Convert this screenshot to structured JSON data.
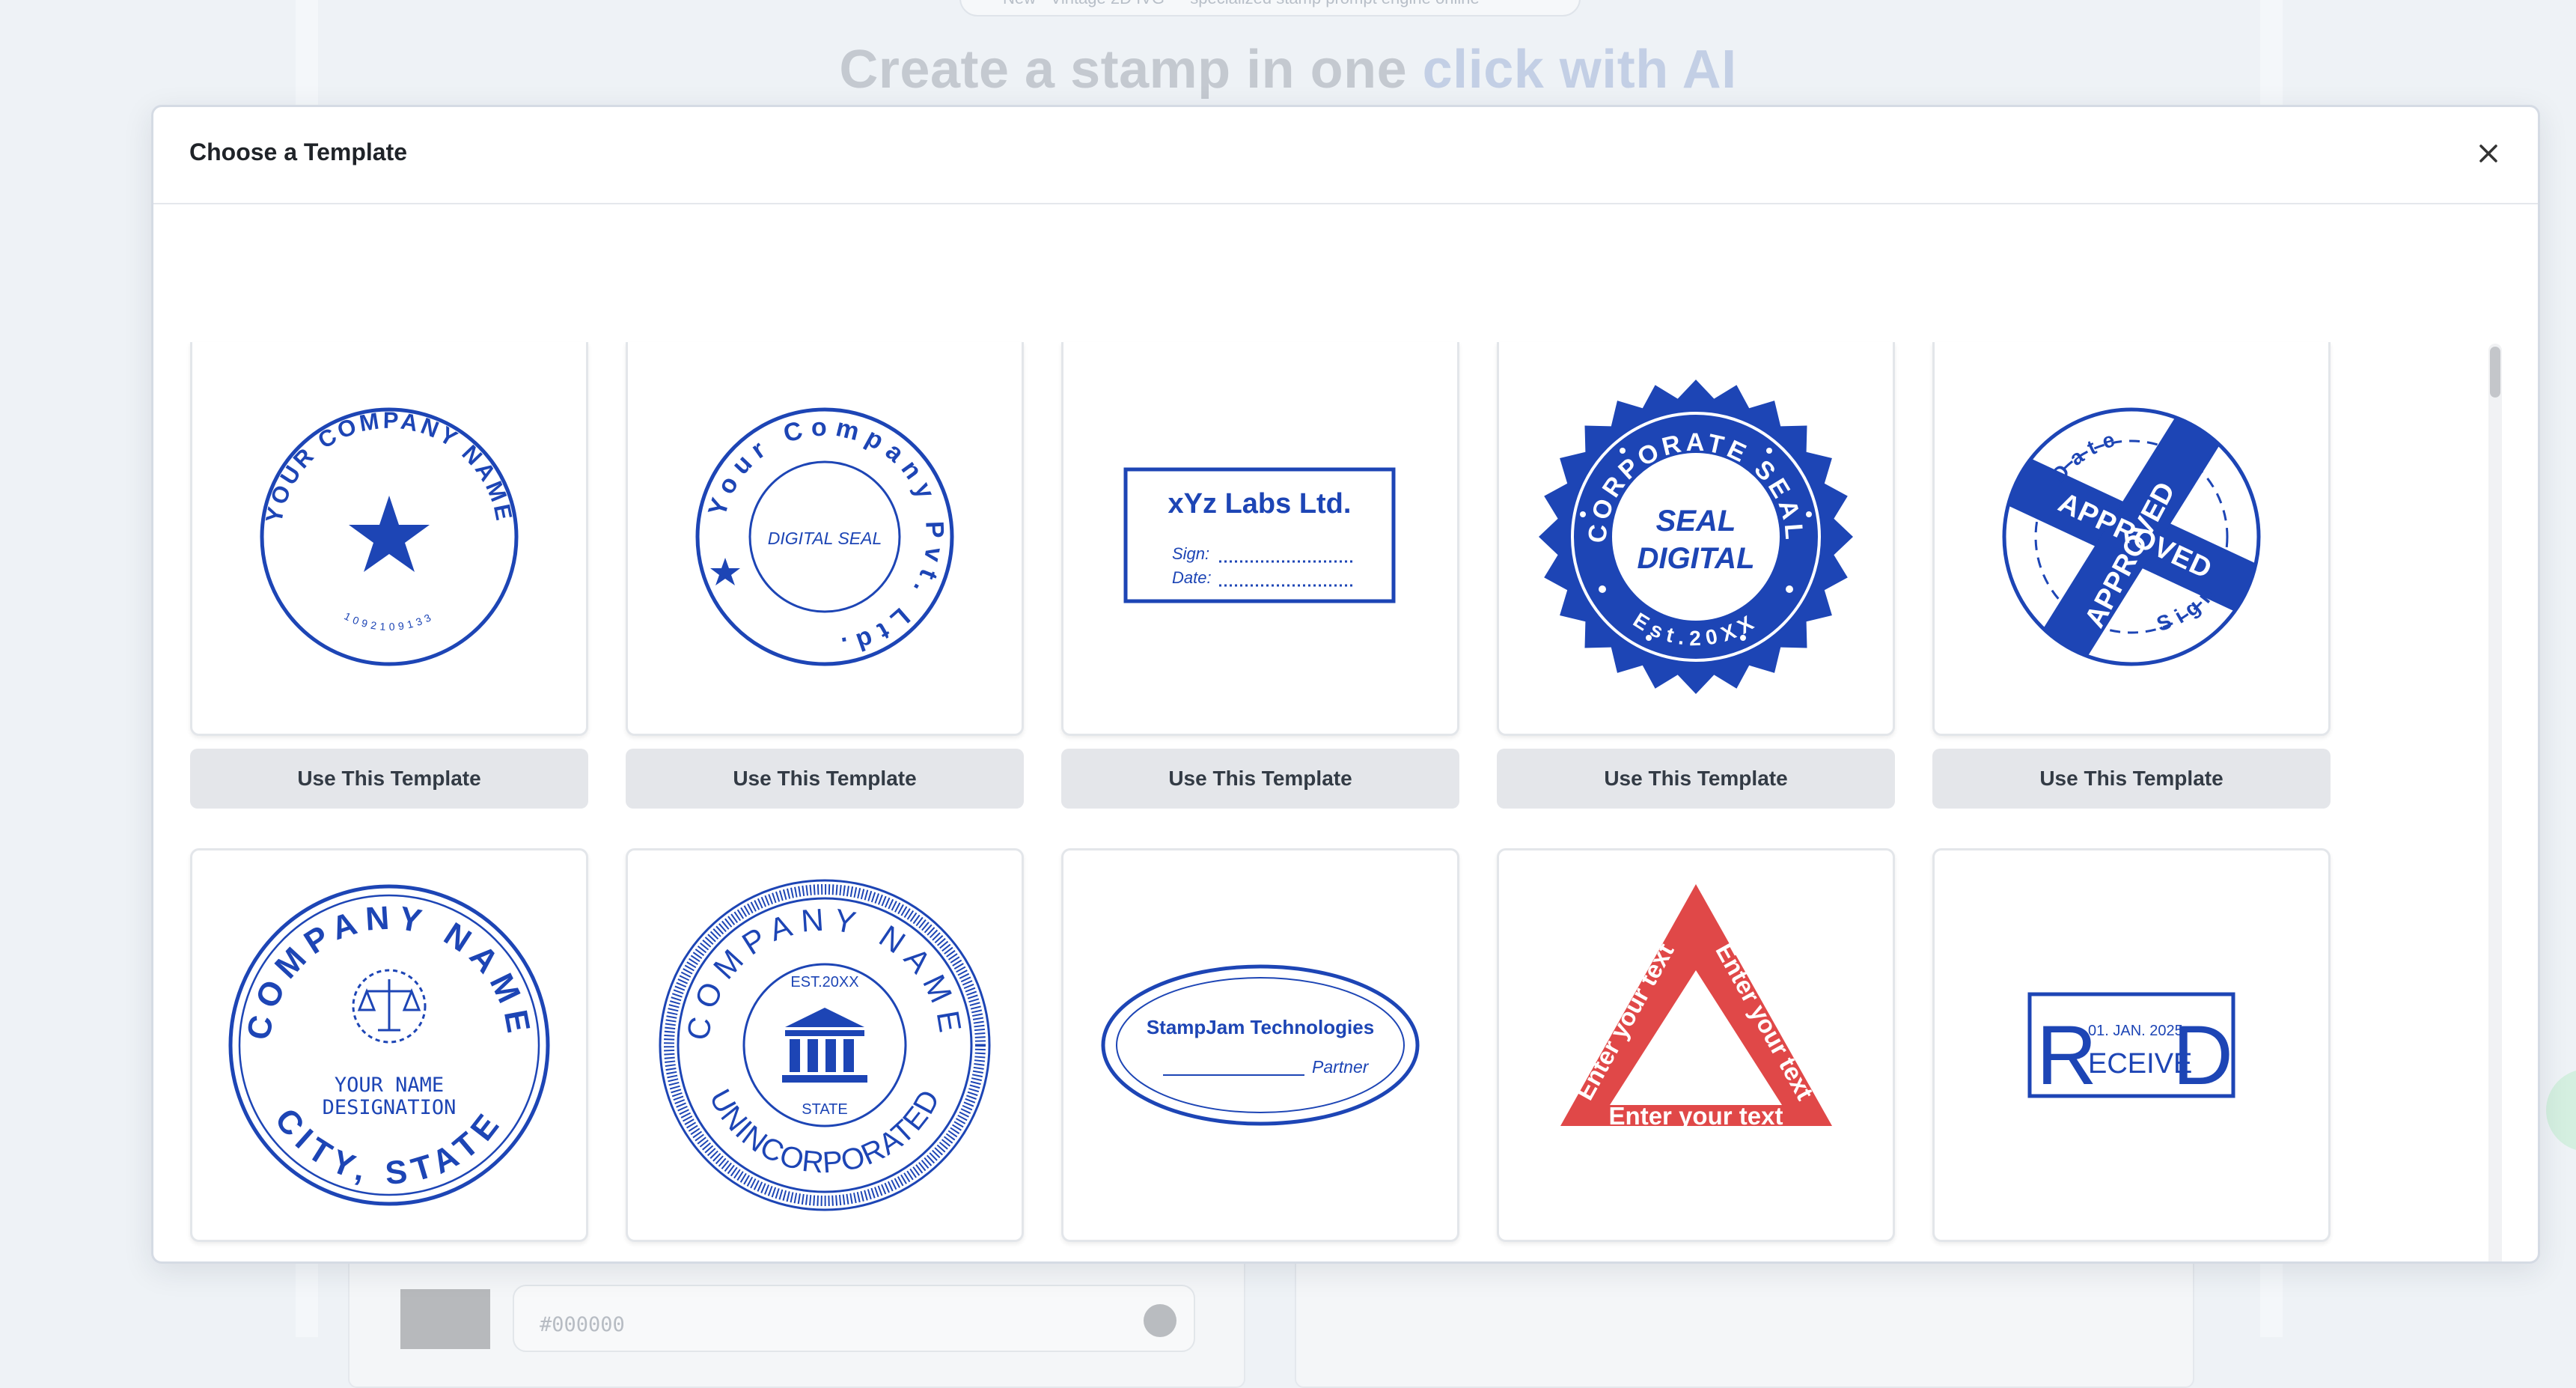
{
  "background": {
    "pill_text": "New · Vintage 2D IVG — specialized stamp prompt engine online",
    "heading_main": "Create a stamp in one ",
    "heading_accent": "click with AI",
    "color_input_value": "#000000"
  },
  "modal": {
    "title": "Choose a Template",
    "button_label": "Use This Template",
    "stamp_color": "#1d45b5",
    "triangle_color": "#e04848",
    "templates": [
      {
        "top_text": "YOUR COMPANY NAME",
        "bottom_text": "1092109133"
      },
      {
        "top_text": "Your Company Pvt. Ltd.",
        "center_text": "DIGITAL SEAL"
      },
      {
        "title": "xYz Labs Ltd.",
        "sign_label": "Sign:",
        "date_label": "Date:"
      },
      {
        "top_text": "CORPORATE SEAL",
        "center_line1": "SEAL",
        "center_line2": "DIGITAL",
        "bottom_text": "Est.20XX"
      },
      {
        "date_text": "Date",
        "approved_1": "APPROVED",
        "approved_2": "APPROVED",
        "sign_text": "Sign"
      },
      {
        "top_text": "COMPANY NAME",
        "name": "YOUR NAME",
        "designation": "DESIGNATION",
        "bottom_text": "CITY, STATE"
      },
      {
        "top_text": "COMPANY NAME",
        "est": "EST.20XX",
        "state": "STATE",
        "bottom_text": "UNINCORPORATED"
      },
      {
        "title": "StampJam Technologies",
        "role": "Partner"
      },
      {
        "left_text": "Enter your text",
        "right_text": "Enter your text",
        "bottom_text": "Enter your text"
      },
      {
        "date": "01. JAN. 2025",
        "big_r": "R",
        "middle": "ECEIVE",
        "big_d": "D"
      }
    ]
  }
}
